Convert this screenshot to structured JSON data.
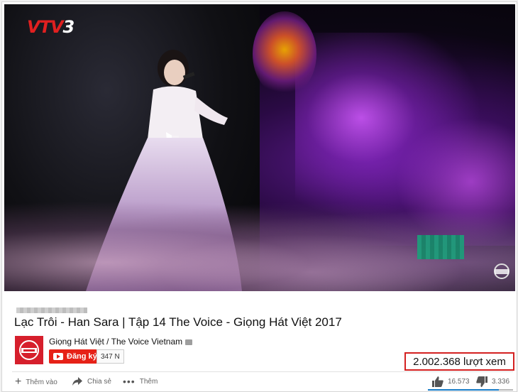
{
  "video": {
    "channel_logo_text": "VTV3",
    "logo_parts": [
      "VTV",
      "3"
    ]
  },
  "title": "Lạc Trôi - Han Sara | Tập 14 The Voice - Giọng Hát Việt 2017",
  "channel": {
    "name": "Giọng Hát Việt / The Voice Vietnam",
    "subscribe_label": "Đăng ký",
    "subscriber_count": "347 N"
  },
  "views": "2.002.368 lượt xem",
  "actions": {
    "add_to": "Thêm vào",
    "share": "Chia sẻ",
    "more": "Thêm"
  },
  "likes": {
    "like_count": "16.573",
    "dislike_count": "3.336",
    "like_ratio": 0.83
  },
  "colors": {
    "subscribe_red": "#e62117",
    "highlight_border": "#d42020",
    "like_blue": "#167ac6"
  },
  "icons": [
    "add-icon",
    "share-icon",
    "more-icon",
    "thumbs-up-icon",
    "thumbs-down-icon",
    "verified-icon",
    "youtube-icon"
  ]
}
